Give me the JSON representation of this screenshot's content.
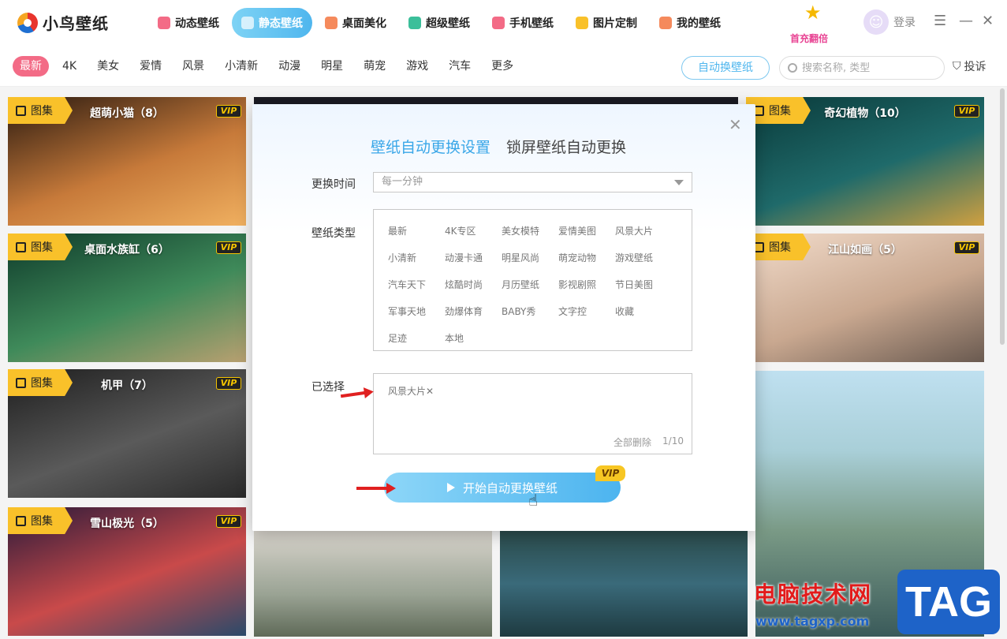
{
  "app": {
    "logo_text": "小鸟壁纸",
    "nav": [
      {
        "label": "动态壁纸",
        "icon": "video-icon",
        "color": "#f36b86",
        "active": false
      },
      {
        "label": "静态壁纸",
        "icon": "image-icon",
        "color": "#ffffff",
        "active": true
      },
      {
        "label": "桌面美化",
        "icon": "brush-icon",
        "color": "#f58a5c",
        "active": false
      },
      {
        "label": "超级壁纸",
        "icon": "star-icon",
        "color": "#3bbf9a",
        "active": false
      },
      {
        "label": "手机壁纸",
        "icon": "phone-icon",
        "color": "#f36b86",
        "active": false
      },
      {
        "label": "图片定制",
        "icon": "diy-icon",
        "color": "#f9c12a",
        "active": false
      },
      {
        "label": "我的壁纸",
        "icon": "user-icon",
        "color": "#f58a5c",
        "active": false
      }
    ],
    "promo_text": "首充翻倍",
    "login_label": "登录"
  },
  "categories": {
    "items": [
      "最新",
      "4K",
      "美女",
      "爱情",
      "风景",
      "小清新",
      "动漫",
      "明星",
      "萌宠",
      "游戏",
      "汽车",
      "更多"
    ],
    "active_index": 0,
    "auto_button": "自动换壁纸",
    "search_placeholder": "搜索名称, 类型",
    "report_label": "投诉"
  },
  "cards": [
    {
      "badge": "图集",
      "title": "超萌小猫（8）",
      "vip": "VIP",
      "colors": [
        "#2a1a10",
        "#c77a3a",
        "#f0b060"
      ]
    },
    {
      "badge": "图集",
      "title": "桌面水族缸（6）",
      "vip": "VIP",
      "colors": [
        "#0e3a2a",
        "#3f8a5a",
        "#b8a070"
      ]
    },
    {
      "badge": "图集",
      "title": "机甲（7）",
      "vip": "VIP",
      "colors": [
        "#1e1e1e",
        "#5a5a5a",
        "#2a2a2a"
      ]
    },
    {
      "badge": "图集",
      "title": "雪山极光（5）",
      "vip": "VIP",
      "colors": [
        "#2a1a3a",
        "#c94a4a",
        "#2a4a6a"
      ]
    },
    {
      "badge": "图集",
      "title": "奇幻植物（10）",
      "vip": "VIP",
      "colors": [
        "#0a3a3a",
        "#1f6a6a",
        "#d0a040"
      ]
    },
    {
      "badge": "图集",
      "title": "江山如画（5）",
      "vip": "VIP",
      "colors": [
        "#f2dccb",
        "#c9a890",
        "#6a5a50"
      ]
    }
  ],
  "modal": {
    "tabs": [
      "壁纸自动更换设置",
      "锁屏壁纸自动更换"
    ],
    "interval_label": "更换时间",
    "interval_value": "每一分钟",
    "type_label": "壁纸类型",
    "types": [
      "最新",
      "4K专区",
      "美女模特",
      "爱情美图",
      "风景大片",
      "小清新",
      "动漫卡通",
      "明星风尚",
      "萌宠动物",
      "游戏壁纸",
      "汽车天下",
      "炫酷时尚",
      "月历壁纸",
      "影视剧照",
      "节日美图",
      "军事天地",
      "劲爆体育",
      "BABY秀",
      "文字控",
      "收藏",
      "足迹",
      "本地"
    ],
    "selected_label": "已选择",
    "selected_chip": "风景大片✕",
    "clear_all": "全部删除",
    "count": "1/10",
    "start_button": "开始自动更换壁纸",
    "vip_tag": "VIP"
  },
  "watermark": {
    "cn": "电脑技术网",
    "url": "www.tagxp.com",
    "tag": "TAG"
  }
}
